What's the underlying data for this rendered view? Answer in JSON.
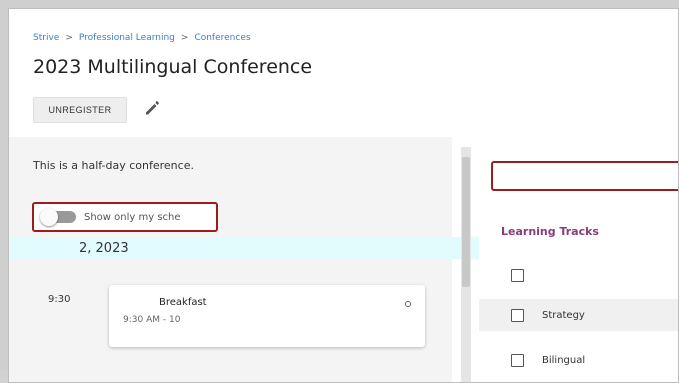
{
  "breadcrumb": {
    "items": [
      "Strive",
      "Professional Learning",
      "Conferences"
    ],
    "separator": ">"
  },
  "page": {
    "title": "2023 Multilingual Conference"
  },
  "actions": {
    "unregister_label": "UNREGISTER",
    "edit_icon": "pencil-icon"
  },
  "conference": {
    "description": "This is a half-day conference."
  },
  "schedule_toggle": {
    "label": "Show only my sche",
    "checked": false
  },
  "day": {
    "date_label": "2, 2023"
  },
  "sessions": [
    {
      "time": "9:30",
      "title": "Breakfast",
      "time_range": "9:30 AM - 10"
    }
  ],
  "tracks": {
    "heading": "Learning Tracks",
    "items": [
      {
        "label": "",
        "checked": false
      },
      {
        "label": "Strategy",
        "checked": false
      },
      {
        "label": "Bilingual",
        "checked": false
      }
    ]
  },
  "colors": {
    "link": "#3d7fc4",
    "highlight_border": "#9b1c1c",
    "tracks_heading": "#8a3b7a",
    "date_bar": "#e2fbfd"
  }
}
